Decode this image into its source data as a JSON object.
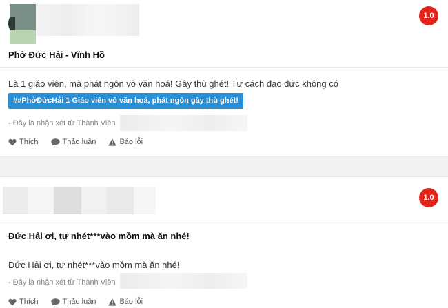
{
  "reviews": [
    {
      "score": "1.0",
      "title": "Phở Đức Hải - Vĩnh Hồ",
      "body": "Là 1 giáo viên, mà phát ngôn vô văn hoá! Gây thù ghét! Tư cách đạo đức không có",
      "tag": "##PhởĐứcHải 1 Giáo viên vô văn hoá, phát ngôn gây thù ghét!",
      "meta": "- Đây là nhận xét từ Thành Viên",
      "actions": {
        "like": "Thích",
        "discuss": "Thảo luận",
        "report": "Báo lỗi"
      }
    },
    {
      "score": "1.0",
      "title": "Đức Hải ơi, tự nhét***vào mồm mà ăn nhé!",
      "body": "Đức Hải ơi, tự nhét***vào mồm mà ăn nhé!",
      "meta": "- Đây là nhận xét từ Thành Viên",
      "actions": {
        "like": "Thích",
        "discuss": "Thảo luận",
        "report": "Báo lỗi"
      }
    }
  ],
  "colors": {
    "score_badge": "#e1251b",
    "tag": "#2b8fd6",
    "separator": "#f1f2f4"
  },
  "icons": {
    "like": "heart-icon",
    "discuss": "chat-bubble-icon",
    "report": "warning-icon"
  }
}
